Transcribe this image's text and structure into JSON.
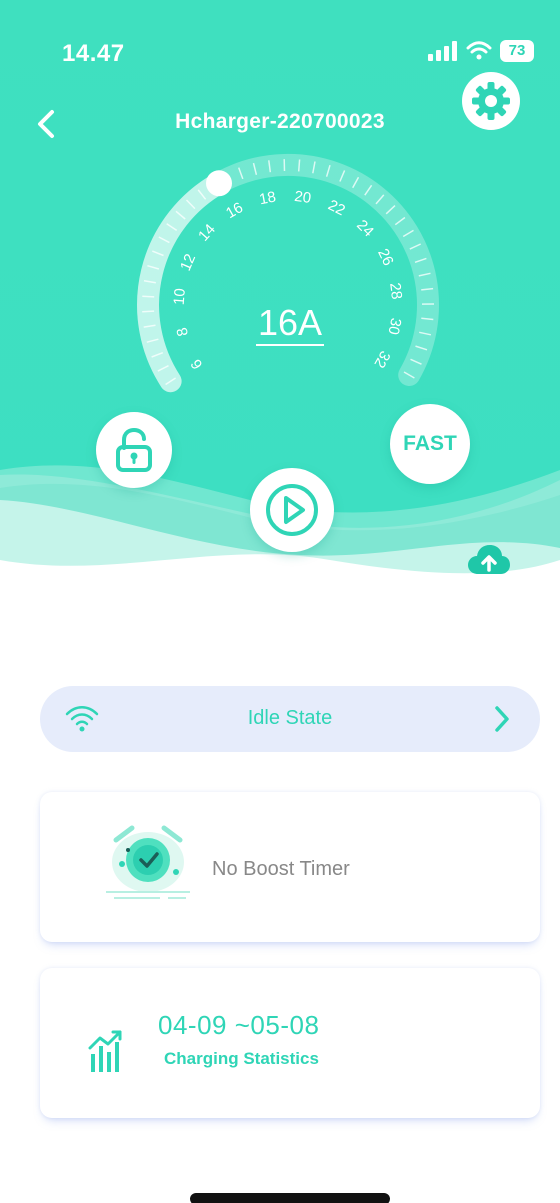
{
  "status_bar": {
    "time": "14.47",
    "battery": "73"
  },
  "header": {
    "title": "Hcharger-220700023"
  },
  "gauge": {
    "current_value": "16A",
    "ticks": [
      "6",
      "8",
      "10",
      "12",
      "14",
      "16",
      "18",
      "20",
      "22",
      "24",
      "26",
      "28",
      "30",
      "32"
    ],
    "min": 6,
    "max": 32,
    "selected": 16
  },
  "controls": {
    "fast_label": "FAST"
  },
  "state": {
    "label": "Idle State"
  },
  "timer": {
    "label": "No Boost Timer"
  },
  "stats": {
    "range": "04-09 ~05-08",
    "label": "Charging Statistics"
  },
  "colors": {
    "accent": "#2fd5b6",
    "state_bar_bg": "#e6ecfb",
    "muted_text": "#888888"
  },
  "icons": [
    "back-icon",
    "gear-icon",
    "unlock-icon",
    "play-icon",
    "upload-cloud-icon",
    "wifi-icon",
    "chevron-right-icon",
    "alarm-clock-icon",
    "bar-chart-icon"
  ]
}
